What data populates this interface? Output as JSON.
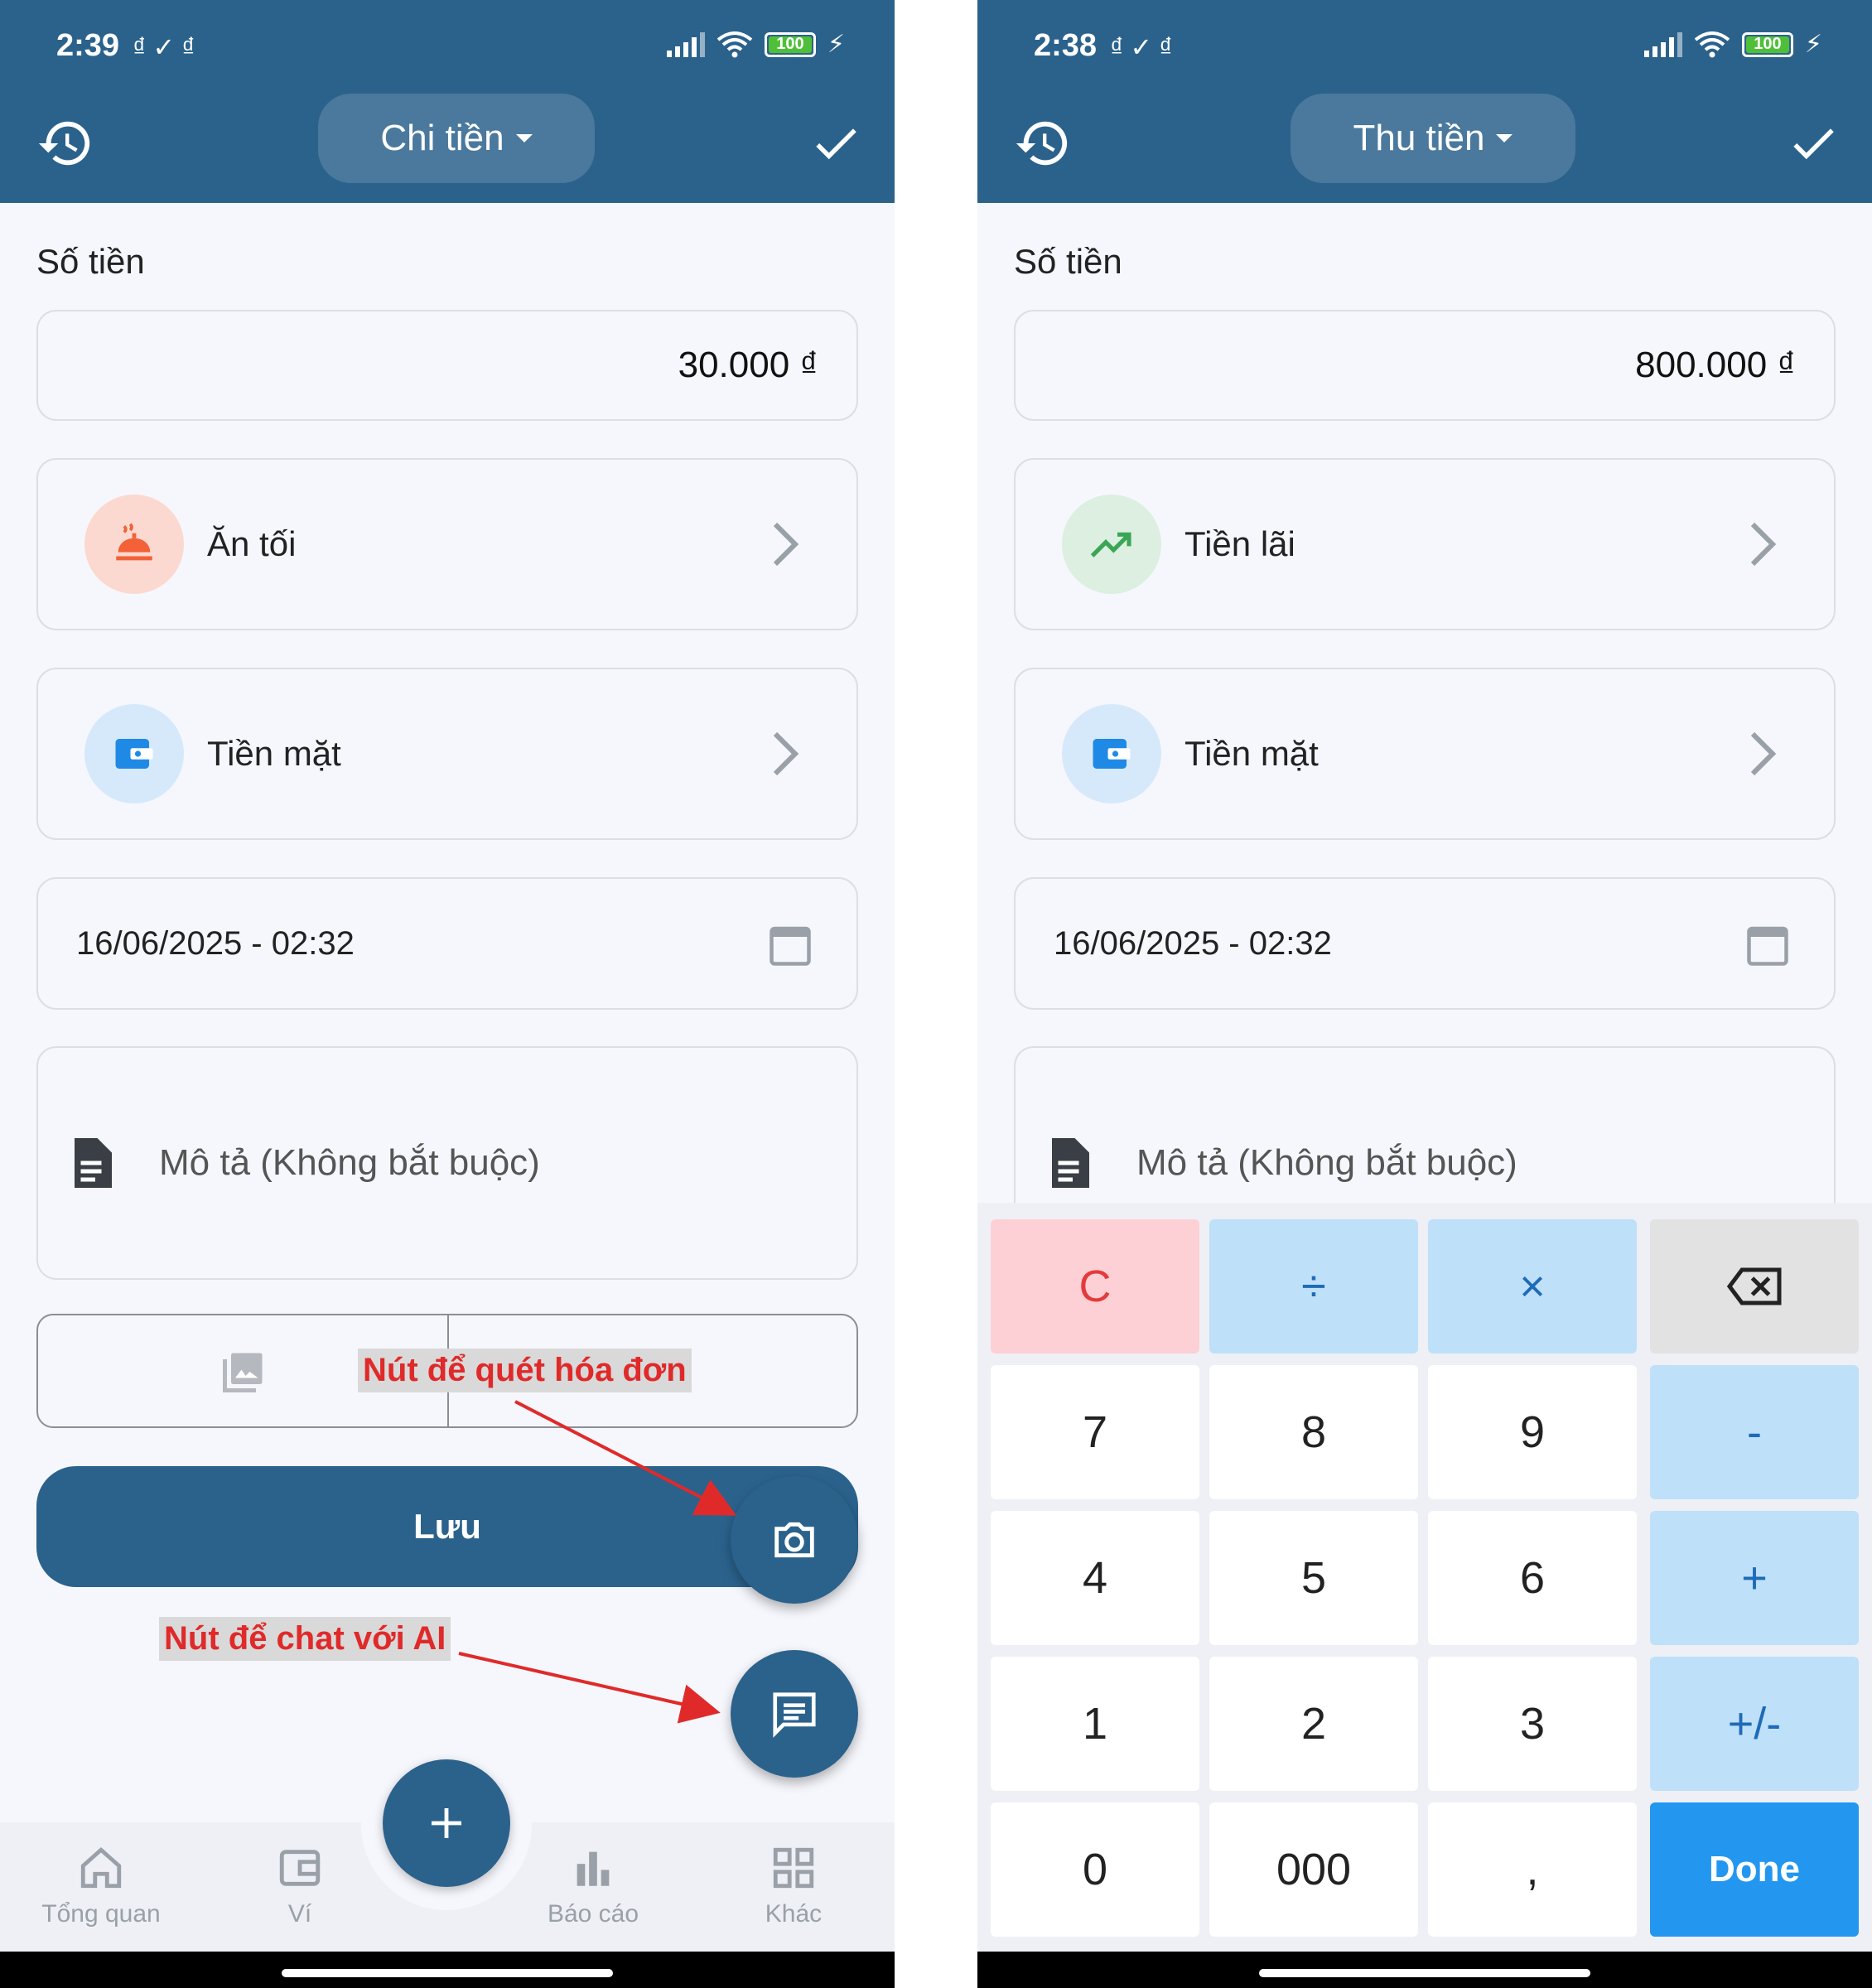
{
  "left": {
    "status_time": "2:39",
    "battery": "100",
    "type_label": "Chi tiền",
    "amount_label": "Số tiền",
    "amount_value": "30.000 ₫",
    "category": "Ăn tối",
    "wallet": "Tiền mặt",
    "datetime": "16/06/2025 - 02:32",
    "description_placeholder": "Mô tả (Không bắt buộc)",
    "save_label": "Lưu",
    "annotation_scan": "Nút để quét hóa đơn",
    "annotation_chat": "Nút để chat với AI",
    "nav": [
      "Tổng quan",
      "Ví",
      "Báo cáo",
      "Khác"
    ]
  },
  "right": {
    "status_time": "2:38",
    "battery": "100",
    "type_label": "Thu tiền",
    "amount_label": "Số tiền",
    "amount_value": "800.000 ₫",
    "category": "Tiền lãi",
    "wallet": "Tiền mặt",
    "datetime": "16/06/2025 - 02:32",
    "description_placeholder": "Mô tả (Không bắt buộc)",
    "keypad": {
      "clear": "C",
      "divide": "÷",
      "multiply": "×",
      "k7": "7",
      "k8": "8",
      "k9": "9",
      "minus": "-",
      "k4": "4",
      "k5": "5",
      "k6": "6",
      "plus": "+",
      "k1": "1",
      "k2": "2",
      "k3": "3",
      "sign": "+/-",
      "k0": "0",
      "k000": "000",
      "comma": ",",
      "done": "Done"
    }
  },
  "colors": {
    "primary": "#2b628c",
    "background": "#f6f7fc",
    "annotation_text": "#e02a2a",
    "category_expense_bg": "#fbd9d0",
    "category_income_bg": "#dcefe0",
    "wallet_bg": "#d6e9fb",
    "done_key": "#2397f0"
  }
}
